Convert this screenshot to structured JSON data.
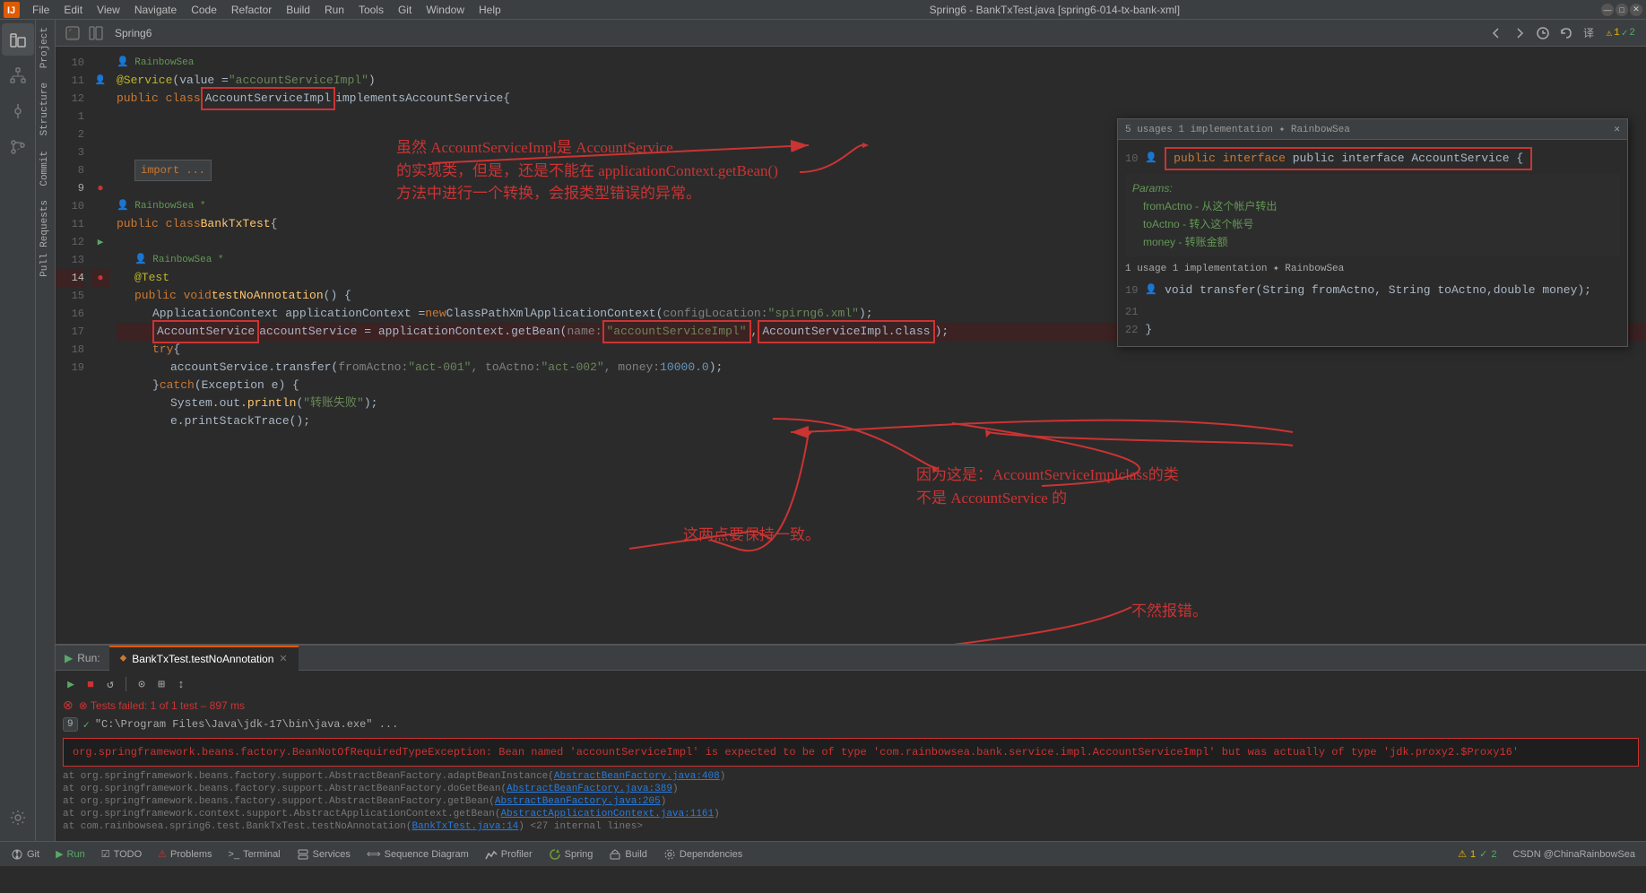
{
  "window": {
    "title": "Spring6 - BankTxTest.java [spring6-014-tx-bank-xml]",
    "min": "—",
    "max": "□",
    "close": "✕"
  },
  "menubar": {
    "items": [
      "File",
      "Edit",
      "View",
      "Navigate",
      "Code",
      "Refactor",
      "Build",
      "Run",
      "Tools",
      "Git",
      "Window",
      "Help"
    ]
  },
  "toolbar": {
    "spring_label": "Spring6",
    "icons": [
      "⇧",
      "⇩",
      "⏱",
      "↺",
      "🌐"
    ]
  },
  "sidebar": {
    "labels": [
      "Project",
      "Structure",
      "Commit",
      "Pull Requests",
      "≡"
    ]
  },
  "code": {
    "lines": [
      {
        "num": "10",
        "content": "@Service(value = \"accountServiceImpl\")",
        "type": "annotation"
      },
      {
        "num": "11",
        "content": "public class AccountServiceImpl implements AccountService {",
        "type": "class"
      },
      {
        "num": "12",
        "content": "",
        "type": "empty"
      },
      {
        "num": "1",
        "content": "",
        "type": "empty"
      },
      {
        "num": "2",
        "content": "",
        "type": "empty"
      },
      {
        "num": "3",
        "content": "    import ...",
        "type": "import"
      },
      {
        "num": "8",
        "content": "",
        "type": "empty"
      },
      {
        "num": "9",
        "content": "public class BankTxTest {",
        "type": "class"
      },
      {
        "num": "10",
        "content": "",
        "type": "empty"
      },
      {
        "num": "11",
        "content": "    @Test",
        "type": "annotation2"
      },
      {
        "num": "12",
        "content": "    public void testNoAnnotation() {",
        "type": "method"
      },
      {
        "num": "13",
        "content": "        ApplicationContext applicationContext = new ClassPathXmlApplicationContext( configLocation: \"spirng6.xml\");",
        "type": "code"
      },
      {
        "num": "14",
        "content": "        AccountService accountService = applicationContext.getBean( name: \"accountServiceImpl\", AccountServiceImpl.class);",
        "type": "code_highlighted"
      },
      {
        "num": "15",
        "content": "        try {",
        "type": "code"
      },
      {
        "num": "16",
        "content": "            accountService.transfer( fromActno: \"act-001\", toActno: \"act-002\", money: 10000.0);",
        "type": "code"
      },
      {
        "num": "17",
        "content": "        } catch (Exception e) {",
        "type": "code"
      },
      {
        "num": "18",
        "content": "            System.out.println(\"转账失败\");",
        "type": "code"
      },
      {
        "num": "19",
        "content": "            e.printStackTrace();",
        "type": "code"
      }
    ]
  },
  "popup": {
    "header_left": "5 usages  1 implementation  ✦ RainbowSea",
    "line_num_10": "10",
    "code_line": "public interface AccountService {",
    "params_label": "Params:",
    "param1": "fromActno - 从这个帐户转出",
    "param2": "toActno - 转入这个帐号",
    "param3": "money - 转账金额",
    "usage_line": "1 usage   1 implementation   ✦ RainbowSea",
    "method_line": "void transfer(String fromActno, String toActno,double money);",
    "line_19": "19",
    "line_21": "21",
    "line_22": "22",
    "close_brace": "}"
  },
  "annotations": {
    "text1": "虽然 AccountServiceImpl是 AccountService\n的实现类，但是，还是不能在 applicationContext.getBean()\n方法中进行一个转换，会报类型错误的异常。",
    "text2": "因为这是：AccountServiceImplclass的类\n不是 AccountService 的",
    "text3": "这两点要保持一致。",
    "text4": "不然报错。",
    "author": "RainbowSea",
    "author2": "RainbowSea *"
  },
  "run_panel": {
    "tab_label": "BankTxTest.testNoAnnotation",
    "tab_close": "✕",
    "test_fail": "⊗ Tests failed: 1 of 1 test – 897 ms",
    "cmd_line": "\"C:\\Program Files\\Java\\jdk-17\\bin\\java.exe\" ...",
    "error_text": "org.springframework.beans.factory.BeanNotOfRequiredTypeException: Bean named 'accountServiceImpl' is expected to be of type 'com.rainbowsea.bank.service.impl.AccountServiceImpl' but was actually of type 'jdk.proxy2.$Proxy16'",
    "stack": [
      "at org.springframework.beans.factory.support.AbstractBeanFactory.adaptBeanInstance(AbstractBeanFactory.java:408)",
      "at org.springframework.beans.factory.support.AbstractBeanFactory.doGetBean(AbstractBeanFactory.java:389)",
      "at org.springframework.beans.factory.support.AbstractBeanFactory.getBean(AbstractBeanFactory.java:205)",
      "at org.springframework.context.support.AbstractApplicationContext.getBean(AbstractApplicationContext.java:1161)",
      "at com.rainbowsea.spring6.test.BankTxTest.testNoAnnotation(BankTxTest.java:14) <27 internal lines>"
    ],
    "badge_num": "9"
  },
  "statusbar": {
    "git_label": "Git",
    "run_label": "Run",
    "todo_label": "TODO",
    "problems_label": "Problems",
    "terminal_label": "Terminal",
    "services_label": "Services",
    "sequence_label": "Sequence Diagram",
    "profiler_label": "Profiler",
    "spring_label": "Spring",
    "build_label": "Build",
    "dependencies_label": "Dependencies",
    "right_text": "CSDN @ChinaRainbowSea",
    "error_count": "1",
    "warn_count": "2"
  }
}
